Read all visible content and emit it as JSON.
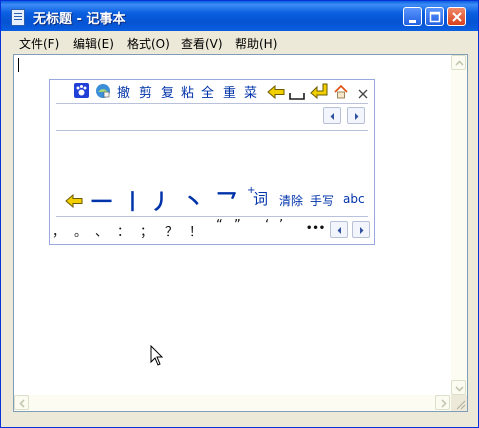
{
  "window": {
    "title": "无标题 - 记事本"
  },
  "menu": [
    "文件(F)",
    "编辑(E)",
    "格式(O)",
    "查看(V)",
    "帮助(H)"
  ],
  "ime": {
    "toolbar": [
      "撤",
      "剪",
      "复",
      "粘",
      "全",
      "重",
      "菜"
    ],
    "strokes": [
      "一",
      "丨",
      "丿",
      "丶",
      "乛"
    ],
    "ci_prefix": "+",
    "ci": "词",
    "clear": "清除",
    "handwrite": "手写",
    "abc": "abc",
    "punct": [
      "，",
      "。",
      "、",
      "：",
      "；",
      "？",
      "！",
      "“",
      "”",
      "‘",
      "’",
      "…"
    ],
    "ellipsis": "•••"
  },
  "colors": {
    "title_blue": "#0a5fe0",
    "ime_text": "#0033aa",
    "arrow_yellow": "#f2d000"
  },
  "icons": [
    "paw-icon",
    "skin-icon",
    "back-arrow-icon",
    "space-icon",
    "enter-icon",
    "home-icon",
    "close-icon"
  ]
}
